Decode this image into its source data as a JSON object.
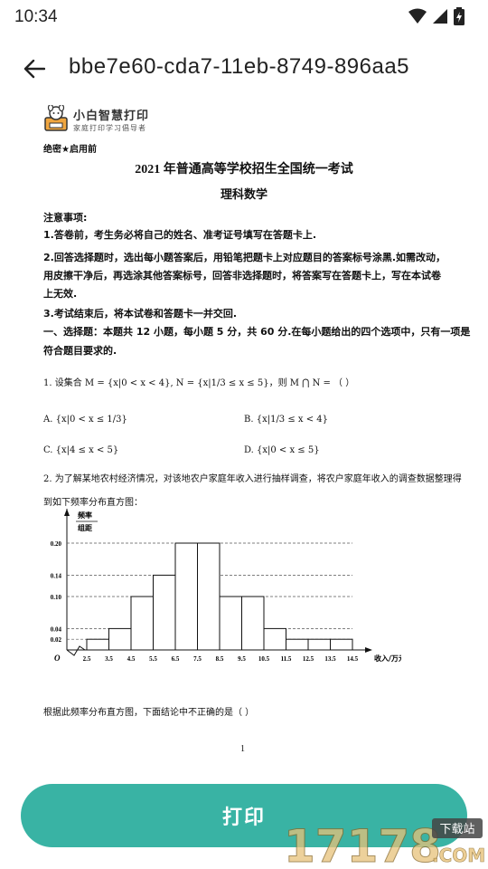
{
  "status_bar": {
    "time": "10:34"
  },
  "app_bar": {
    "title": "bbe7e60-cda7-11eb-8749-896aa5"
  },
  "document": {
    "logo_main": "小白智慧打印",
    "logo_sub": "家庭打印学习倡导者",
    "secret": "绝密★启用前",
    "title": "2021 年普通高等学校招生全国统一考试",
    "subject": "理科数学",
    "notes_header": "注意事项:",
    "notes": [
      "1.答卷前，考生务必将自己的姓名、准考证号填写在答题卡上.",
      "2.回答选择题时，选出每小题答案后，用铅笔把题卡上对应题目的答案标号涂黑.如需改动，",
      "用皮擦干净后，再选涂其他答案标号，回答非选择题时，将答案写在答题卡上，写在本试卷",
      "上无效.",
      "3.考试结束后，将本试卷和答题卡一并交回."
    ],
    "section1": [
      "一、选择题：本题共 12 小题，每小题 5 分，共 60 分.在每小题给出的四个选项中，只有一项是",
      "符合题目要求的."
    ],
    "q1": {
      "stem": "1. 设集合 M = {x|0 < x < 4}, N = {x|1/3 ≤ x ≤ 5}，则 M ⋂ N = （     ）",
      "A": "A.  {x|0 < x ≤ 1/3}",
      "B": "B.  {x|1/3 ≤ x < 4}",
      "C": "C.  {x|4 ≤ x < 5}",
      "D": "D.  {x|0 < x ≤ 5}"
    },
    "q2": {
      "line1": "2. 为了解某地农村经济情况，对该地农户家庭年收入进行抽样调查，将农户家庭年收入的调查数据整理得",
      "line2": "到如下频率分布直方图：",
      "question": "根据此频率分布直方图，下面结论中不正确的是（     ）"
    },
    "page_number": "1"
  },
  "chart_data": {
    "type": "bar",
    "ylabel_top": "频率",
    "ylabel_bottom": "组距",
    "xlabel": "收入/万元",
    "origin_label": "O",
    "x_ticks": [
      "2.5",
      "3.5",
      "4.5",
      "5.5",
      "6.5",
      "7.5",
      "8.5",
      "9.5",
      "10.5",
      "11.5",
      "12.5",
      "13.5",
      "14.5"
    ],
    "y_ticks": [
      "0.20",
      "0.14",
      "0.10",
      "0.04",
      "0.02"
    ],
    "bins": [
      {
        "from": 2.5,
        "to": 3.5,
        "value": 0.02
      },
      {
        "from": 3.5,
        "to": 4.5,
        "value": 0.04
      },
      {
        "from": 4.5,
        "to": 5.5,
        "value": 0.1
      },
      {
        "from": 5.5,
        "to": 6.5,
        "value": 0.14
      },
      {
        "from": 6.5,
        "to": 7.5,
        "value": 0.2
      },
      {
        "from": 7.5,
        "to": 8.5,
        "value": 0.2
      },
      {
        "from": 8.5,
        "to": 9.5,
        "value": 0.1
      },
      {
        "from": 9.5,
        "to": 10.5,
        "value": 0.1
      },
      {
        "from": 10.5,
        "to": 11.5,
        "value": 0.04
      },
      {
        "from": 11.5,
        "to": 12.5,
        "value": 0.02
      },
      {
        "from": 12.5,
        "to": 13.5,
        "value": 0.02
      },
      {
        "from": 13.5,
        "to": 14.5,
        "value": 0.02
      }
    ]
  },
  "print_button": {
    "label": "打印"
  },
  "watermark": {
    "number": "17178",
    "badge": "下载站",
    "suffix": ".COM"
  }
}
